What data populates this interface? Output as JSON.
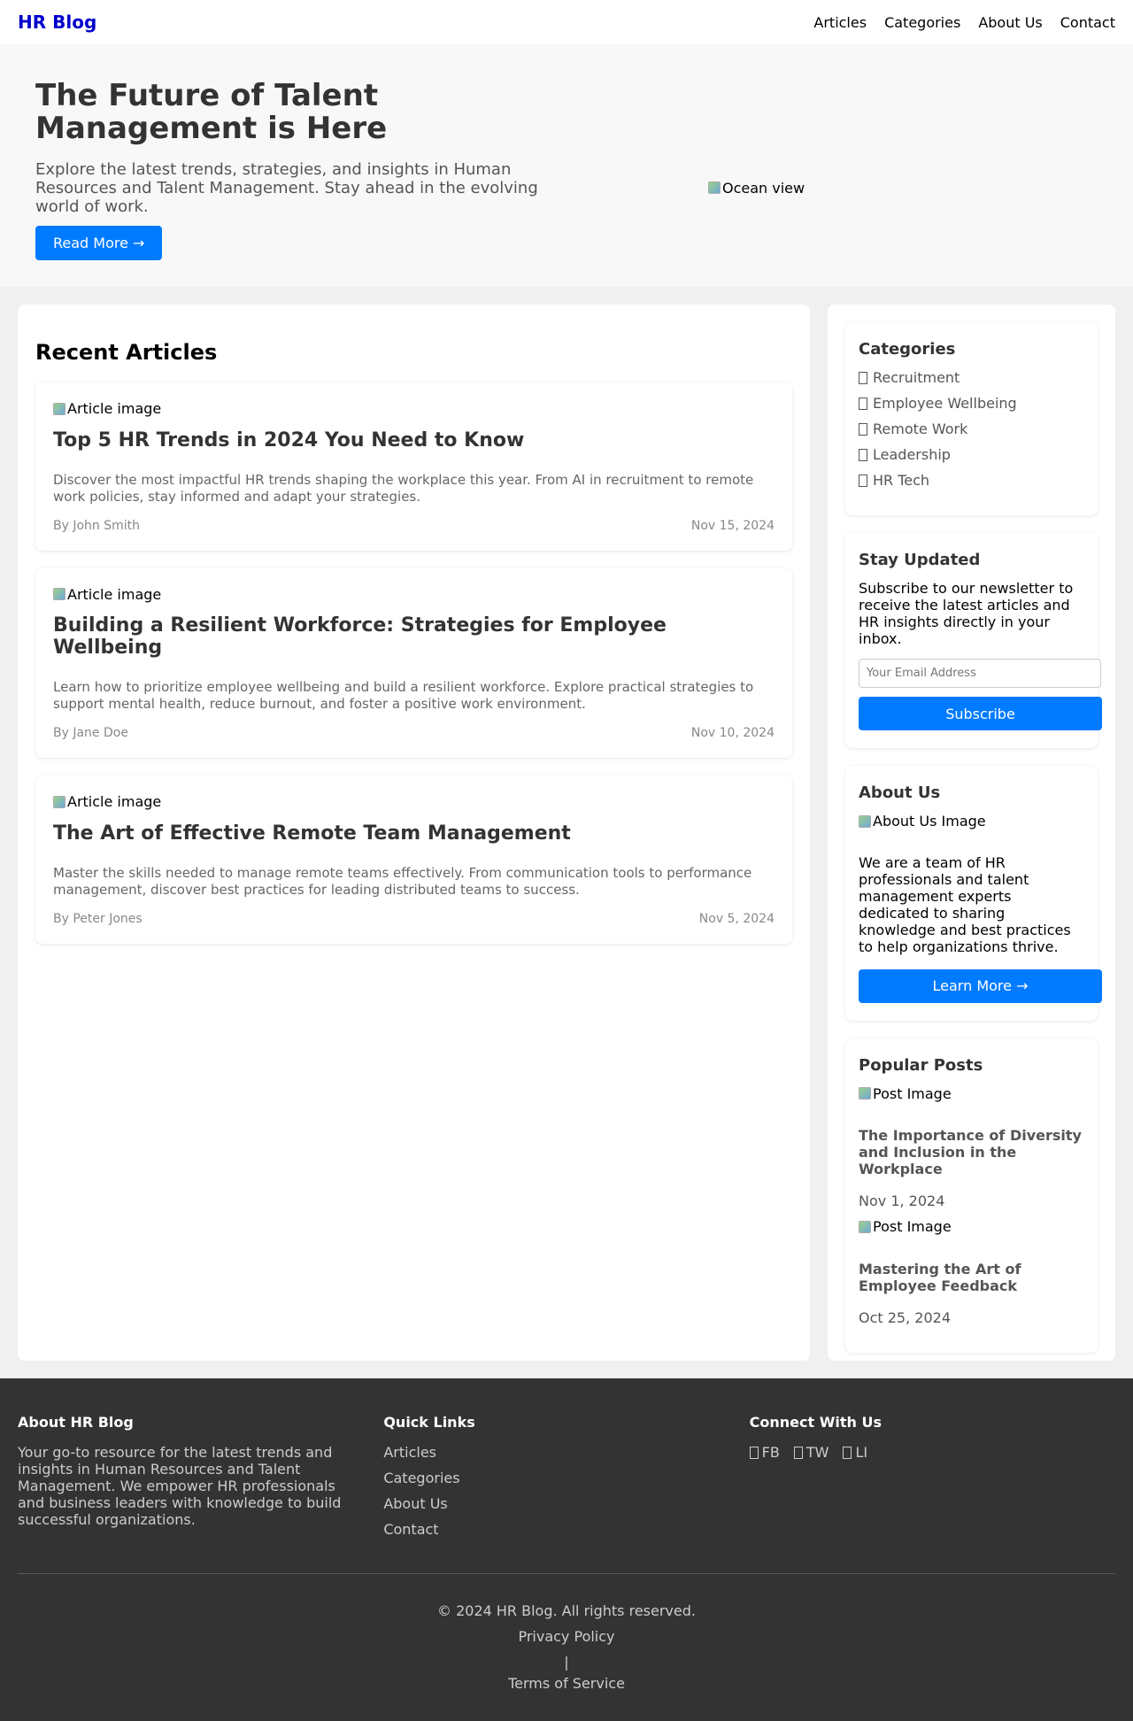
{
  "nav": {
    "logo": "HR Blog",
    "links": [
      "Articles",
      "Categories",
      "About Us",
      "Contact"
    ]
  },
  "hero": {
    "title": "The Future of Talent Management is Here",
    "subtitle": "Explore the latest trends, strategies, and insights in Human Resources and Talent Management. Stay ahead in the evolving world of work.",
    "button": "Read More →",
    "image_alt": "Ocean view"
  },
  "articles": {
    "heading": "Recent Articles",
    "items": [
      {
        "image_alt": "Article image",
        "title": "Top 5 HR Trends in 2024 You Need to Know",
        "excerpt": "Discover the most impactful HR trends shaping the workplace this year. From AI in recruitment to remote work policies, stay informed and adapt your strategies.",
        "author": "By John Smith",
        "date": "Nov 15, 2024"
      },
      {
        "image_alt": "Article image",
        "title": "Building a Resilient Workforce: Strategies for Employee Wellbeing",
        "excerpt": "Learn how to prioritize employee wellbeing and build a resilient workforce. Explore practical strategies to support mental health, reduce burnout, and foster a positive work environment.",
        "author": "By Jane Doe",
        "date": "Nov 10, 2024"
      },
      {
        "image_alt": "Article image",
        "title": "The Art of Effective Remote Team Management",
        "excerpt": "Master the skills needed to manage remote teams effectively. From communication tools to performance management, discover best practices for leading distributed teams to success.",
        "author": "By Peter Jones",
        "date": "Nov 5, 2024"
      }
    ]
  },
  "sidebar": {
    "categories": {
      "heading": "Categories",
      "items": [
        "Recruitment",
        "Employee Wellbeing",
        "Remote Work",
        "Leadership",
        "HR Tech"
      ]
    },
    "newsletter": {
      "heading": "Stay Updated",
      "text": "Subscribe to our newsletter to receive the latest articles and HR insights directly in your inbox.",
      "placeholder": "Your Email Address",
      "button": "Subscribe"
    },
    "about": {
      "heading": "About Us",
      "image_alt": "About Us Image",
      "text": "We are a team of HR professionals and talent management experts dedicated to sharing knowledge and best practices to help organizations thrive.",
      "button": "Learn More →"
    },
    "popular": {
      "heading": "Popular Posts",
      "items": [
        {
          "image_alt": "Post Image",
          "title": "The Importance of Diversity and Inclusion in the Workplace",
          "date": "Nov 1, 2024"
        },
        {
          "image_alt": "Post Image",
          "title": "Mastering the Art of Employee Feedback",
          "date": "Oct 25, 2024"
        }
      ]
    }
  },
  "footer": {
    "about": {
      "heading": "About HR Blog",
      "text": "Your go-to resource for the latest trends and insights in Human Resources and Talent Management. We empower HR professionals and business leaders with knowledge to build successful organizations."
    },
    "quick_links": {
      "heading": "Quick Links",
      "items": [
        "Articles",
        "Categories",
        "About Us",
        "Contact"
      ]
    },
    "connect": {
      "heading": "Connect With Us",
      "items": [
        "FB",
        "TW",
        "LI"
      ]
    },
    "copyright": "© 2024 HR Blog. All rights reserved.",
    "privacy": "Privacy Policy",
    "separator": "|",
    "terms": "Terms of Service"
  },
  "colors": {
    "accent": "#007bff",
    "logo": "#0000cc",
    "footer_bg": "#333333"
  },
  "icons": {
    "category_icon": "missing-glyph-square",
    "social_icon": "missing-glyph-square",
    "broken_image_icon": "broken-image-icon"
  }
}
